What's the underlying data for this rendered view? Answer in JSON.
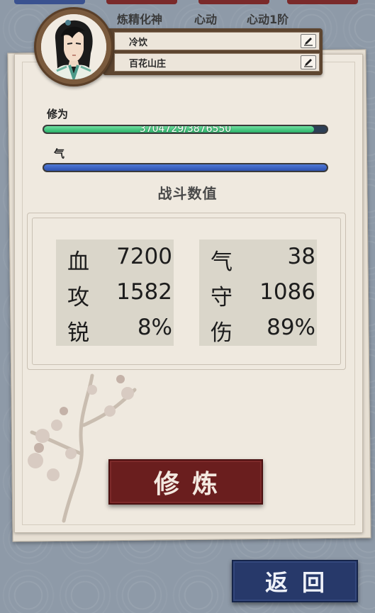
{
  "top_tabs": [
    {
      "label": "炼精化神"
    },
    {
      "label": "心动"
    },
    {
      "label": "心动1阶"
    }
  ],
  "profile": {
    "name": "冷饮",
    "sect": "百花山庄"
  },
  "bars": {
    "xiuwei": {
      "label": "修为",
      "text": "3704729/3876550",
      "current": 3704729,
      "max": 3876550
    },
    "qi": {
      "label": "气",
      "fraction": 1.0
    }
  },
  "section_title": "战斗数值",
  "stats": {
    "left": [
      {
        "name": "血",
        "value": "7200"
      },
      {
        "name": "攻",
        "value": "1582"
      },
      {
        "name": "锐",
        "value": "8%"
      }
    ],
    "right": [
      {
        "name": "气",
        "value": "38"
      },
      {
        "name": "守",
        "value": "1086"
      },
      {
        "name": "伤",
        "value": "89%"
      }
    ]
  },
  "buttons": {
    "cultivate": "修炼",
    "return": "返回"
  },
  "colors": {
    "cultivate_button": "#6a1e1e",
    "return_button": "#27396a",
    "xiuwei_bar": "#2bb26a",
    "qi_bar": "#2d52b0"
  }
}
